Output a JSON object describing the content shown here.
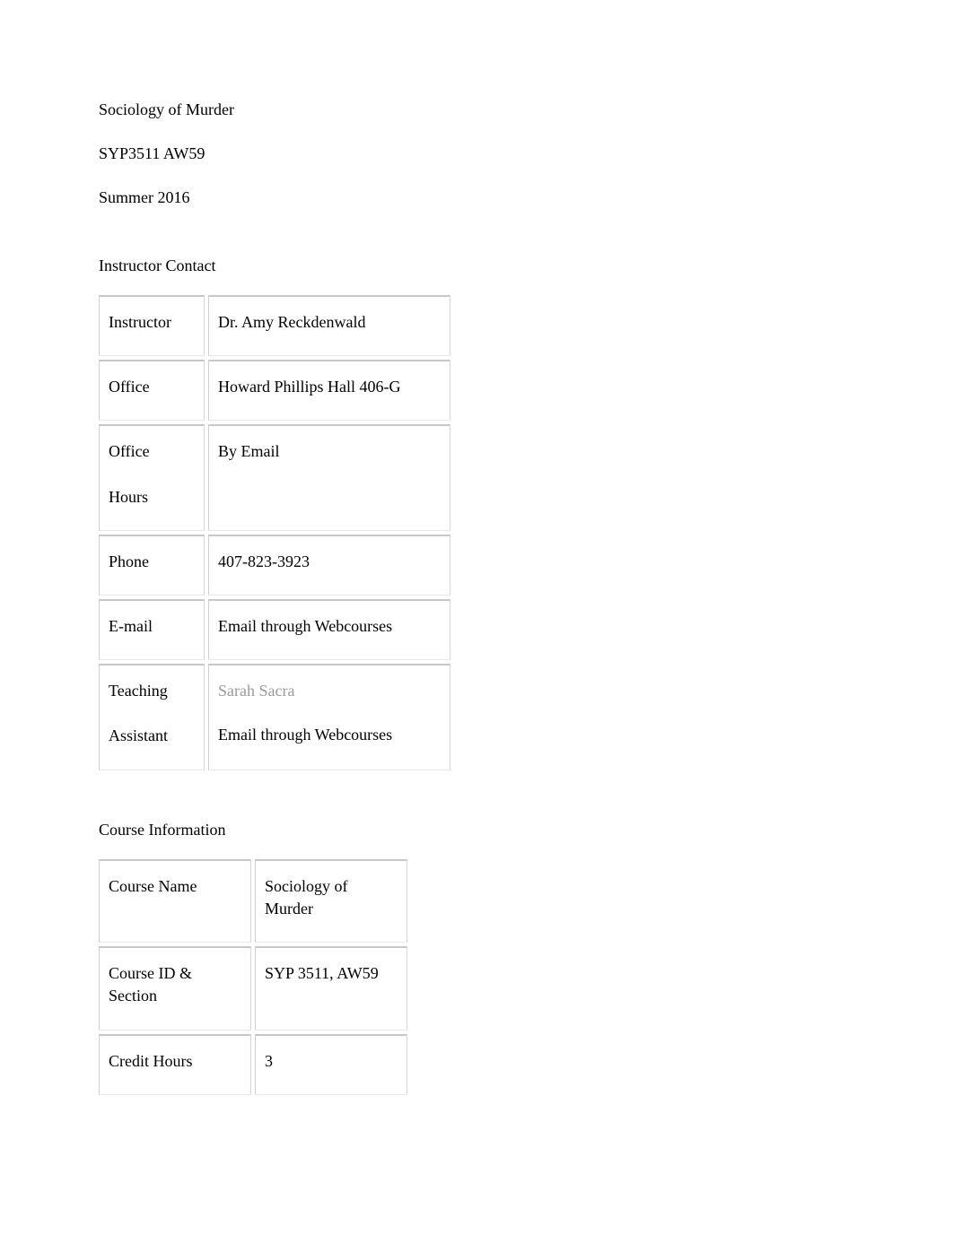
{
  "header": {
    "title": "Sociology of Murder",
    "course_code": "SYP3511 AW59",
    "term": "Summer 2016"
  },
  "instructor_section": {
    "heading": "Instructor Contact",
    "rows": {
      "instructor_label": "Instructor",
      "instructor_value": "Dr. Amy Reckdenwald",
      "office_label": "Office",
      "office_value": "Howard Phillips Hall 406-G",
      "office_hours_label_1": "Office",
      "office_hours_label_2": "Hours",
      "office_hours_value": "By Email",
      "phone_label": "Phone",
      "phone_value": "407-823-3923",
      "email_label": "E-mail",
      "email_value": "Email through Webcourses",
      "ta_label_1": "Teaching",
      "ta_label_2": "Assistant",
      "ta_name": "Sarah Sacra",
      "ta_email": "Email through Webcourses"
    }
  },
  "course_section": {
    "heading": "Course Information",
    "rows": {
      "name_label": "Course Name",
      "name_value": "Sociology of Murder",
      "id_label_1": "Course ID &",
      "id_label_2": "Section",
      "id_value": "SYP 3511, AW59",
      "credit_label": "Credit Hours",
      "credit_value": "3"
    }
  }
}
